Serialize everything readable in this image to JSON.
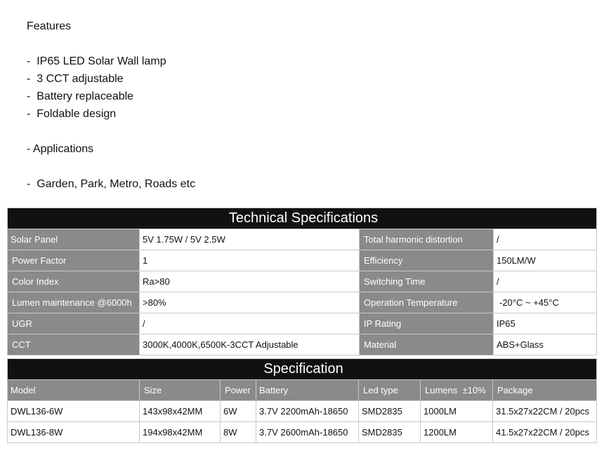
{
  "features": {
    "heading": "Features",
    "items": [
      "-  IP65 LED Solar Wall lamp",
      "-  3 CCT adjustable",
      "-  Battery replaceable",
      "-  Foldable design"
    ],
    "applications_heading": "- Applications",
    "applications_items": [
      "-  Garden, Park, Metro, Roads etc"
    ]
  },
  "tech_specs": {
    "title": "Technical Specifications",
    "rows": [
      {
        "label_left": "Solar Panel",
        "value_left": "5V 1.75W / 5V 2.5W",
        "label_right": "Total harmonic distortion",
        "value_right": "/"
      },
      {
        "label_left": "Power Factor",
        "value_left": "1",
        "label_right": "Efficiency",
        "value_right": "150LM/W"
      },
      {
        "label_left": "Color Index",
        "value_left": "Ra>80",
        "label_right": "Switching Time",
        "value_right": "/"
      },
      {
        "label_left": "Lumen maintenance @6000h",
        "value_left": ">80%",
        "label_right": "Operation Temperature",
        "value_right": "-20°C ~ +45°C"
      },
      {
        "label_left": "UGR",
        "value_left": "/",
        "label_right": "IP Rating",
        "value_right": "IP65"
      },
      {
        "label_left": "CCT",
        "value_left": "3000K,4000K,6500K-3CCT Adjustable",
        "label_right": "Material",
        "value_right": "ABS+Glass"
      }
    ]
  },
  "specification": {
    "title": "Specification",
    "headers": [
      "Model",
      "Size",
      "Power",
      "Battery",
      "Led type",
      "Lumens  ±10%",
      "Package"
    ],
    "rows": [
      [
        "DWL136-6W",
        "143x98x42MM",
        "6W",
        "3.7V 2200mAh-18650",
        "SMD2835",
        "1000LM",
        "31.5x27x22CM / 20pcs"
      ],
      [
        "DWL136-8W",
        "194x98x42MM",
        "8W",
        "3.7V 2600mAh-18650",
        "SMD2835",
        "1200LM",
        "41.5x27x22CM / 20pcs"
      ]
    ]
  },
  "colors": {
    "title_bar": "#111111",
    "label_cell": "#8a8a8a",
    "border": "#c9c9c9"
  }
}
